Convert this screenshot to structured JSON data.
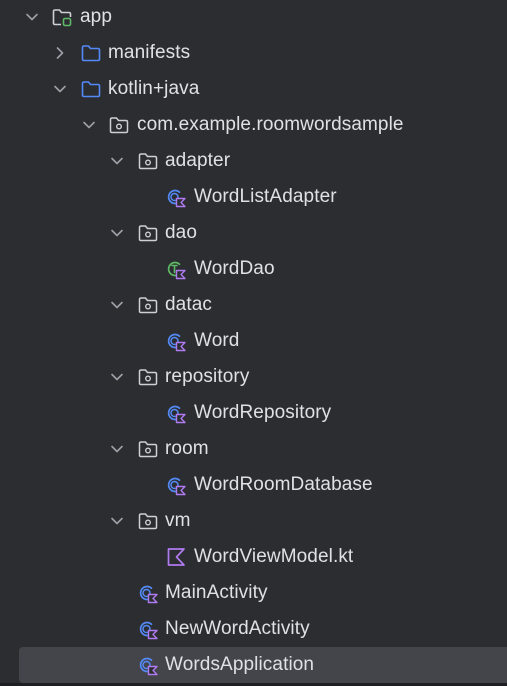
{
  "project_tree": {
    "app": {
      "label": "app",
      "icon": "module-folder-icon"
    },
    "manifests": {
      "label": "manifests",
      "icon": "folder-icon"
    },
    "kotlin_java": {
      "label": "kotlin+java",
      "icon": "source-folder-icon"
    },
    "package": {
      "label": "com.example.roomwordsample",
      "icon": "package-icon"
    },
    "adapter": {
      "label": "adapter",
      "icon": "package-icon"
    },
    "word_list_adapter": {
      "label": "WordListAdapter",
      "icon": "kotlin-class-icon"
    },
    "dao": {
      "label": "dao",
      "icon": "package-icon"
    },
    "word_dao": {
      "label": "WordDao",
      "icon": "kotlin-interface-icon"
    },
    "datac": {
      "label": "datac",
      "icon": "package-icon"
    },
    "word": {
      "label": "Word",
      "icon": "kotlin-class-icon"
    },
    "repository": {
      "label": "repository",
      "icon": "package-icon"
    },
    "word_repository": {
      "label": "WordRepository",
      "icon": "kotlin-class-icon"
    },
    "room": {
      "label": "room",
      "icon": "package-icon"
    },
    "word_room_database": {
      "label": "WordRoomDatabase",
      "icon": "kotlin-class-icon"
    },
    "vm": {
      "label": "vm",
      "icon": "package-icon"
    },
    "word_view_model": {
      "label": "WordViewModel.kt",
      "icon": "kotlin-file-icon"
    },
    "main_activity": {
      "label": "MainActivity",
      "icon": "kotlin-class-icon"
    },
    "new_word_activity": {
      "label": "NewWordActivity",
      "icon": "kotlin-class-icon"
    },
    "words_application": {
      "label": "WordsApplication",
      "icon": "kotlin-class-icon",
      "selected": true
    }
  },
  "colors": {
    "background": "#2b2d30",
    "selection": "#43454a",
    "text": "#dfe1e5",
    "chevron": "#9da0a8",
    "folder_blue": "#548af7",
    "module_green": "#5fb865",
    "class_blue": "#548af7",
    "kotlin_purple": "#b07bf0",
    "interface_green": "#5fb865",
    "package_gray": "#ced0d6"
  }
}
